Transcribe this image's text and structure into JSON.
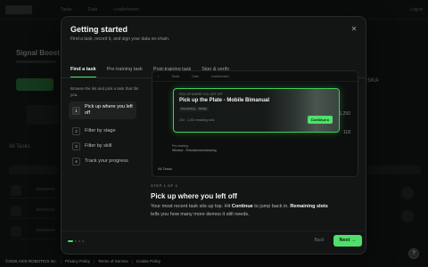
{
  "modal": {
    "title": "Getting started",
    "subtitle": "Find a task, record it, and sign your data on-chain.",
    "close_icon": "close-icon",
    "tabs": [
      {
        "label": "Find a task",
        "active": true
      },
      {
        "label": "Pre-training task",
        "active": false
      },
      {
        "label": "Post-training task",
        "active": false
      },
      {
        "label": "Sign & verify",
        "active": false
      }
    ],
    "steps_intro": "Browse the list and pick a task that fits you.",
    "steps": [
      {
        "num": "1",
        "label": "Pick up where you left off",
        "active": true
      },
      {
        "num": "2",
        "label": "Filter by stage",
        "active": false
      },
      {
        "num": "3",
        "label": "Filter by skill",
        "active": false
      },
      {
        "num": "4",
        "label": "Track your progress",
        "active": false
      }
    ],
    "preview": {
      "card_kicker": "PICK UP WHERE YOU LEFT OFF",
      "card_title": "Pick up the Plate - Mobile Bimanual",
      "tags": [
        "Pre-training",
        "Mobile"
      ],
      "card_meta": "3/10 · 1,200 remaining slots",
      "continue_label": "Continue ▸",
      "stat_1": "1,250",
      "stat_2": "118",
      "row2_kicker": "Pre-training",
      "row2_title": "Window - Robotwindowcleaning",
      "tasks_label": "All Tasks"
    },
    "step_kicker": "STEP 1 OF 4",
    "step_heading": "Pick up where you left off",
    "step_body": {
      "part1": "Your most recent task sits up top. Hit ",
      "bold1": "Continue",
      "part2": " to jump back in. ",
      "bold2": "Remaining slots",
      "part3": " tells you how many more demos it still needs."
    },
    "back_label": "Back",
    "next_label": "Next →",
    "accent": "#4ee06a"
  },
  "background": {
    "hero_title": "Signal Boost",
    "tasks_label": "All Tasks",
    "login": "Log in",
    "nav": [
      "Tasks",
      "Data",
      "Leaderboard"
    ],
    "side_stat": "SKA"
  },
  "footer": {
    "copyright": "©2026 AXIS ROBOTICS Inc.",
    "links": [
      "Privacy Policy",
      "Terms of Service",
      "Cookie Policy"
    ],
    "help_icon": "help-icon"
  }
}
